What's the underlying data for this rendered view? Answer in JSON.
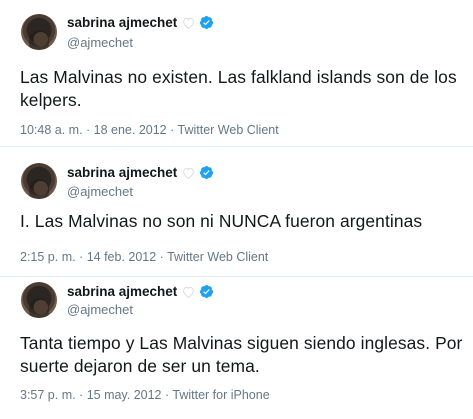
{
  "tweets": [
    {
      "name": "sabrina ajmechet",
      "handle": "@ajmechet",
      "text": "Las Malvinas no existen. Las falkland islands son de los kelpers.",
      "meta": "10:48 a. m. · 18 ene. 2012 · Twitter Web Client"
    },
    {
      "name": "sabrina ajmechet",
      "handle": "@ajmechet",
      "text": "I. Las Malvinas no son ni NUNCA fueron argentinas",
      "meta": "2:15 p. m. · 14 feb. 2012 · Twitter Web Client"
    },
    {
      "name": "sabrina ajmechet",
      "handle": "@ajmechet",
      "text": "Tanta tiempo y Las Malvinas siguen siendo inglesas. Por suerte dejaron de ser un tema.",
      "meta": "3:57 p. m. · 15 may. 2012 · Twitter for iPhone"
    }
  ],
  "colors": {
    "verified": "#1da1f2",
    "secondary_text": "#657786",
    "primary_text": "#14171a",
    "heart": "#d9d9d9"
  },
  "icons": {
    "heart": "white-heart-icon",
    "verified": "verified-badge-icon"
  }
}
